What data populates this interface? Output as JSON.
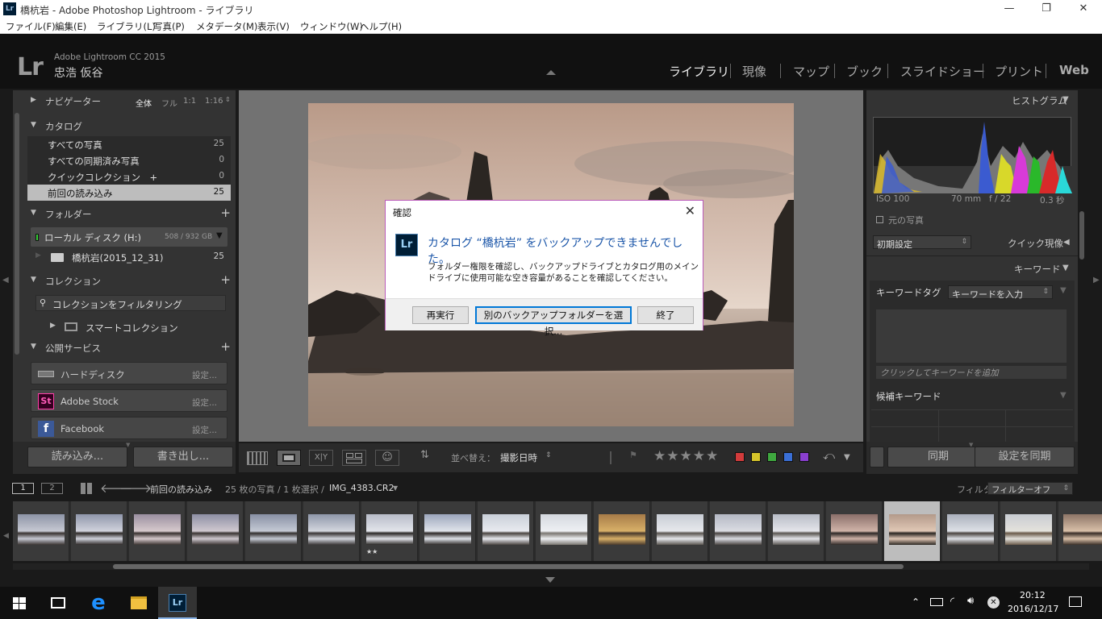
{
  "window": {
    "title": "橋杭岩 - Adobe Photoshop Lightroom - ライブラリ",
    "app_icon": "Lr",
    "controls": [
      "minimize-icon",
      "restore-icon",
      "close-icon"
    ]
  },
  "menu": [
    "ファイル(F)",
    "編集(E)",
    "ライブラリ(L)",
    "写真(P)",
    "メタデータ(M)",
    "表示(V)",
    "ウィンドウ(W)",
    "ヘルプ(H)"
  ],
  "identity": {
    "logo": "Lr",
    "product": "Adobe Lightroom CC 2015",
    "user": "忠浩 仮谷"
  },
  "modules": [
    "ライブラリ",
    "現像",
    "マップ",
    "ブック",
    "スライドショー",
    "プリント",
    "Web"
  ],
  "active_module": "ライブラリ",
  "navigator": {
    "label": "ナビゲーター",
    "zooms": [
      "全体",
      "フル",
      "1:1",
      "1:16"
    ]
  },
  "catalog": {
    "label": "カタログ",
    "items": [
      {
        "label": "すべての写真",
        "count": "25"
      },
      {
        "label": "すべての同期済み写真",
        "count": "0"
      },
      {
        "label": "クイックコレクション　+",
        "count": "0"
      },
      {
        "label": "前回の読み込み",
        "count": "25"
      }
    ]
  },
  "folders": {
    "label": "フォルダー",
    "volume": "ローカル ディスク (H:)",
    "volume_size": "508 / 932 GB",
    "items": [
      {
        "label": "橋杭岩(2015_12_31)",
        "count": "25"
      }
    ]
  },
  "collections": {
    "label": "コレクション",
    "filter_placeholder": "コレクションをフィルタリング",
    "smart": "スマートコレクション"
  },
  "publish": {
    "label": "公開サービス",
    "services": [
      {
        "name": "ハードディスク",
        "settings": "設定..."
      },
      {
        "name": "Adobe Stock",
        "settings": "設定..."
      },
      {
        "name": "Facebook",
        "settings": "設定..."
      }
    ]
  },
  "left_buttons": {
    "import": "読み込み...",
    "export": "書き出し..."
  },
  "toolbar": {
    "sort_label": "並べ替え：",
    "sort_value": "撮影日時",
    "stars": "★★★★★",
    "color_labels": [
      "#d23b3b",
      "#d6c42a",
      "#3fa83f",
      "#3a6fd6",
      "#8a3fd0"
    ]
  },
  "right": {
    "histogram": "ヒストグラム",
    "iso": "ISO 100",
    "focal": "70 mm",
    "aperture": "f / 22",
    "shutter": "0.3 秒",
    "original": "元の写真",
    "preset": "初期設定",
    "quick_develop": "クイック現像",
    "keywords": "キーワード",
    "keyword_tags": "キーワードタグ",
    "keyword_entry": "キーワードを入力",
    "keyword_add": "クリックしてキーワードを追加",
    "suggestions": "候補キーワード"
  },
  "right_buttons": {
    "sync": "同期",
    "sync_settings": "設定を同期"
  },
  "dialog": {
    "title": "確認",
    "icon": "Lr",
    "heading": "カタログ “橋杭岩” をバックアップできませんでした。",
    "body": "フォルダー権限を確認し、バックアップドライブとカタログ用のメインドライブに使用可能な空き容量があることを確認してください。",
    "buttons": {
      "retry": "再実行",
      "choose": "別のバックアップフォルダーを選択...",
      "quit": "終了"
    }
  },
  "filmstrip_bar": {
    "screens": [
      "1",
      "2"
    ],
    "source": "前回の読み込み",
    "count": "25 枚の写真 / 1 枚選択 /",
    "file": "IMG_4383.CR2",
    "filter_label": "フィルター：",
    "filter_value": "フィルターオフ"
  },
  "filmstrip": {
    "count": 19,
    "selected_index": 15,
    "stars_on_index": 6,
    "stars": "★★"
  },
  "taskbar": {
    "time": "20:12",
    "date": "2016/12/17"
  }
}
